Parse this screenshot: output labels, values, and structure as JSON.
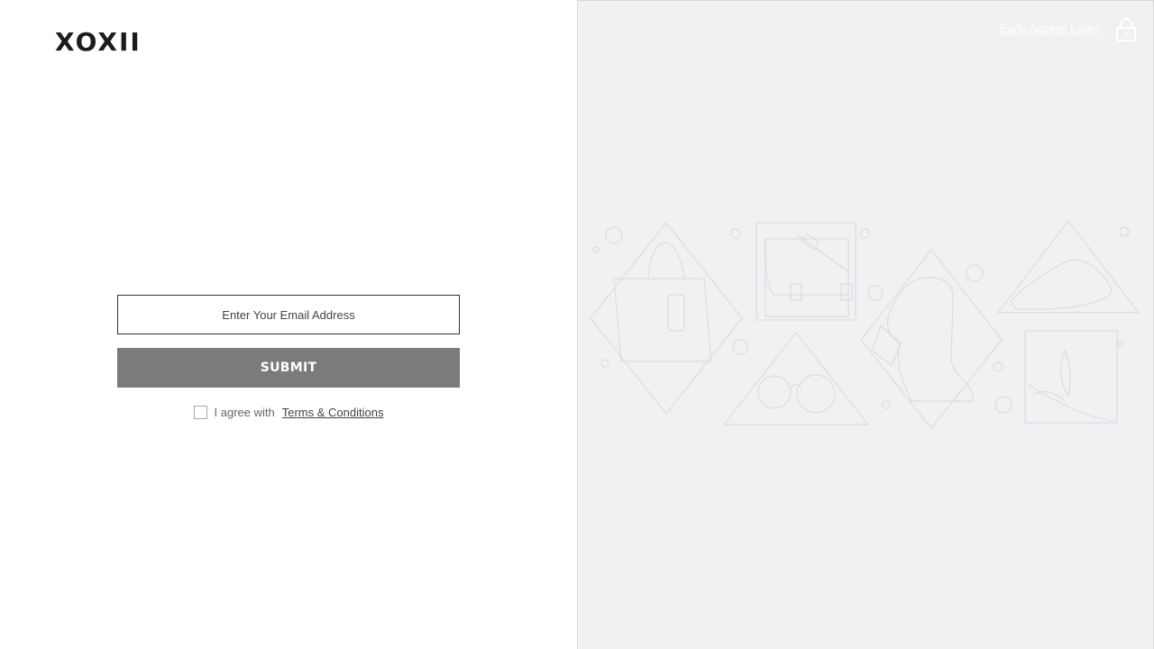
{
  "brand": {
    "logo": "XOXII"
  },
  "form": {
    "email_placeholder": "Enter Your Email Address",
    "submit_label": "SUBMIT",
    "agree_text": "I agree with",
    "terms_link": "Terms & Conditions"
  },
  "header": {
    "early_access_label": "Early Access Login"
  },
  "icons": {
    "lock": "lock-icon",
    "illustration": "fashion-items-illustration"
  },
  "colors": {
    "submit_bg": "#7b7b7b",
    "right_bg": "#f0f1f3",
    "text_dark": "#1c1c1c"
  }
}
